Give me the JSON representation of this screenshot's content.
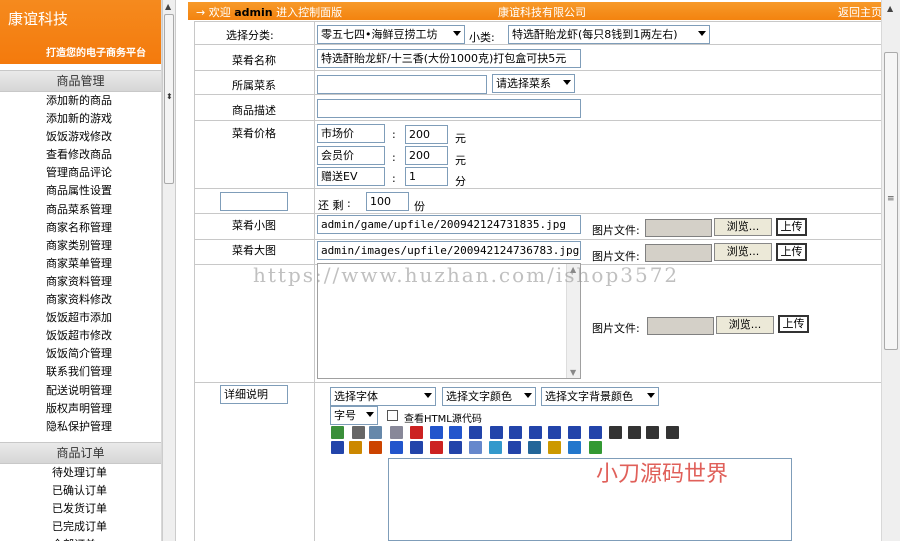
{
  "sidebar": {
    "brand": "康谊科技",
    "slogan": "打造您的电子商务平台",
    "section1": "商品管理",
    "items": [
      "添加新的商品",
      "添加新的游戏",
      "饭饭游戏修改",
      "查看修改商品",
      "管理商品评论",
      "商品属性设置",
      "商品菜系管理",
      "商家名称管理",
      "商家类别管理",
      "商家菜单管理",
      "商家资料管理",
      "商家资料修改",
      "饭饭超市添加",
      "饭饭超市修改",
      "饭饭简介管理",
      "联系我们管理",
      "配送说明管理",
      "版权声明管理",
      "隐私保护管理"
    ],
    "section2": "商品订单",
    "orders": [
      "待处理订单",
      "已确认订单",
      "已发货订单",
      "已完成订单",
      "全部订单"
    ]
  },
  "topbar": {
    "arrow": "→",
    "welcome_prefix": "欢迎",
    "user": "admin",
    "welcome_suffix": "进入控制面版",
    "company": "康谊科技有限公司",
    "home": "返回主页"
  },
  "form": {
    "category_label": "选择分类:",
    "category_value": "零五七四•海鲜豆捞工坊",
    "subcategory_label": "小类:",
    "subcategory_value": "特选酐貽龙虾(每只8钱到1两左右)",
    "dish_name_label": "菜肴名称",
    "dish_name_value": "特选酐貽龙虾/十三香(大份1000克)打包盒可抉5元",
    "cuisine_label": "所属菜系",
    "cuisine_value": "",
    "cuisine_select": "请选择菜系",
    "desc_label": "商品描述",
    "desc_value": "",
    "price_label": "菜肴价格",
    "market_price_label": "市场价",
    "market_price_value": "200",
    "member_price_label": "会员价",
    "member_price_value": "200",
    "gift_ev_label": "赠送EV",
    "gift_ev_value": "1",
    "colon": ":",
    "unit_yuan": "元",
    "unit_fen": "分",
    "remain_label": "还 剩",
    "remain_value": "100",
    "unit_portion": "份",
    "small_img_label": "菜肴小图",
    "small_img_value": "admin/game/upfile/200942124731835.jpg",
    "big_img_label": "菜肴大图",
    "big_img_value": "admin/images/upfile/200942124736783.jpg",
    "file_label": "图片文件:",
    "browse": "浏览...",
    "upload": "上传",
    "detail_label": "详细说明",
    "font_select": "选择字体",
    "color_select": "选择文字颜色",
    "bgcolor_select": "选择文字背景颜色",
    "size_select": "字号",
    "html_source": "查看HTML源代码"
  },
  "watermark": "https://www.huzhan.com/ishop3572",
  "watermark2": "小刀源码世界",
  "colors": {
    "accent": "#f47f10"
  }
}
